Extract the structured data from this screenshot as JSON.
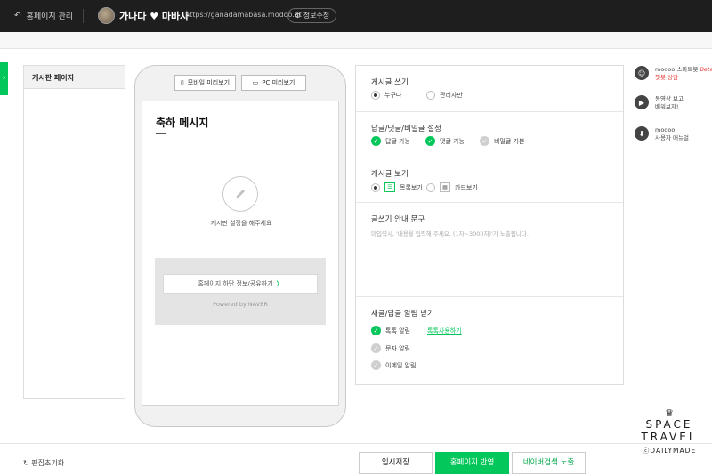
{
  "topbar": {
    "back_label": "홈페이지 관리",
    "site_title": "가나다 ♥ 마바사",
    "site_url": "https://ganadamabasa.modoo.at",
    "info_edit_label": "정보수정"
  },
  "side_tab": {
    "arrow": "›"
  },
  "board_list": {
    "header": "게시판 페이지"
  },
  "preview": {
    "mobile_label": "모바일 미리보기",
    "pc_label": "PC 미리보기",
    "page_title": "축하 메시지",
    "empty_message": "게시판 설정을 해주세요",
    "share_label": "홈페이지 하단 정보/공유하기",
    "share_arrow": "〉",
    "powered": "Powered by NAVER"
  },
  "settings": {
    "write": {
      "label": "게시글 쓰기",
      "options": [
        "누구나",
        "관리자만"
      ],
      "selected": 0
    },
    "reply": {
      "label": "답글/댓글/비밀글 설정",
      "options": [
        {
          "text": "답글 가능",
          "checked": true
        },
        {
          "text": "댓글 가능",
          "checked": true
        },
        {
          "text": "비밀글 기본",
          "checked": false
        }
      ]
    },
    "view": {
      "label": "게시글 보기",
      "options": [
        "목록보기",
        "카드보기"
      ],
      "selected": 0
    },
    "guide": {
      "label": "글쓰기 안내 문구",
      "placeholder": "미입력시, '내용을 입력해 주세요. (1자~3000자)'가 노출됩니다."
    },
    "notify": {
      "label": "새글/답글 알림 받기",
      "options": [
        {
          "text": "톡톡 알림",
          "checked": true
        },
        {
          "text": "문자 알림",
          "checked": false
        },
        {
          "text": "이메일 알림",
          "checked": false
        }
      ],
      "talk_link": "톡톡사용하기"
    }
  },
  "help": [
    {
      "line1": "modoo 스마트봇",
      "beta": "Beta",
      "line2": "챗봇 상담",
      "icon": "robot-icon"
    },
    {
      "line1": "동영상 보고",
      "line2": "배워보자!",
      "icon": "video-icon"
    },
    {
      "line1": "modoo",
      "line2": "사용자 매뉴얼",
      "icon": "manual-icon"
    }
  ],
  "bottom": {
    "reset_label": "편집초기화",
    "save_label": "임시저장",
    "apply_label": "홈페이지 반영",
    "naver_label": "네이버검색 노출"
  },
  "watermark": {
    "line1": "SPACE",
    "line2": "TRAVEL",
    "line3": "ⓒDAILYMADE"
  },
  "colors": {
    "accent": "#03c75a",
    "topbar": "#1e1e1e"
  }
}
